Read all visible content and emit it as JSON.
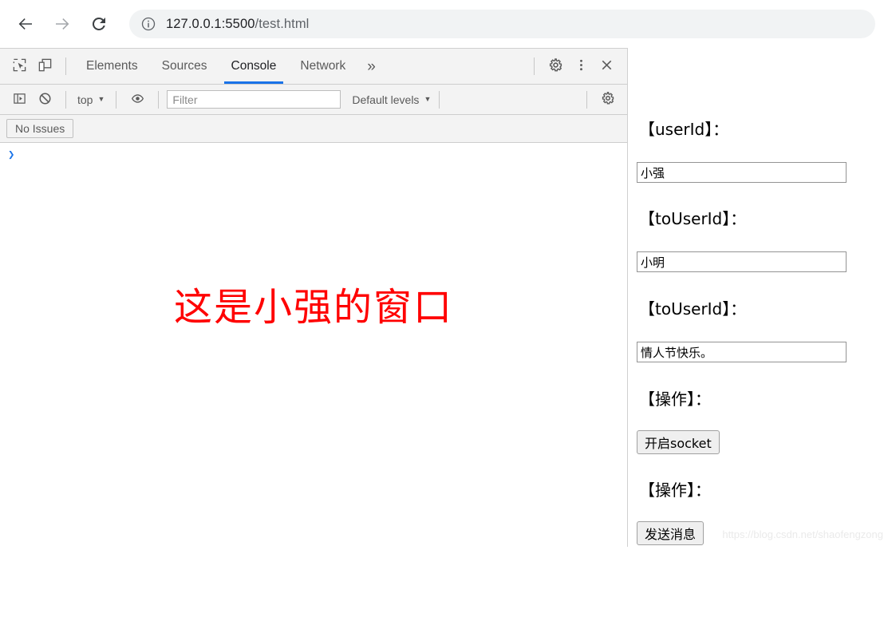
{
  "browser": {
    "back_icon": "arrow-left-icon",
    "forward_icon": "arrow-right-icon",
    "reload_icon": "reload-icon",
    "info_icon": "info-circle-icon",
    "url_host": "127.0.0.1:5500",
    "url_path": "/test.html",
    "url_full": "127.0.0.1:5500/test.html"
  },
  "devtools": {
    "inspect_icon": "inspect-element-icon",
    "device_icon": "device-toolbar-icon",
    "tabs": [
      {
        "label": "Elements",
        "active": false
      },
      {
        "label": "Sources",
        "active": false
      },
      {
        "label": "Console",
        "active": true
      },
      {
        "label": "Network",
        "active": false
      }
    ],
    "more_tabs_label": "»",
    "settings_icon": "gear-icon",
    "menu_icon": "three-dots-vertical-icon",
    "close_icon": "close-icon",
    "console_toolbar": {
      "sidebar_icon": "console-sidebar-icon",
      "clear_icon": "clear-console-icon",
      "context_label": "top",
      "context_caret": "▼",
      "eye_icon": "live-expression-eye-icon",
      "filter_placeholder": "Filter",
      "filter_value": "",
      "levels_label": "Default levels",
      "levels_caret": "▼",
      "settings_icon": "gear-icon"
    },
    "issues_button_label": "No Issues",
    "prompt_symbol": "❯",
    "accent_color": "#1a73e8",
    "toolbar_bg": "#f3f3f3"
  },
  "page": {
    "heading": "这是小强的窗口",
    "heading_color": "#ff0000",
    "fields": [
      {
        "label": "【userId】：",
        "value": "小强"
      },
      {
        "label": "【toUserId】：",
        "value": "小明"
      },
      {
        "label": "【toUserId】：",
        "value": "情人节快乐。"
      }
    ],
    "actions": [
      {
        "label": "【操作】：",
        "button": "开启socket"
      },
      {
        "label": "【操作】：",
        "button": "发送消息"
      }
    ],
    "watermark": "https://blog.csdn.net/shaofengzong"
  }
}
